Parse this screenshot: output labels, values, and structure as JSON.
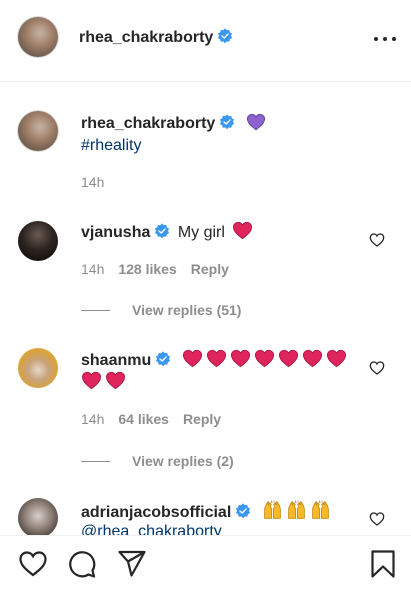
{
  "header": {
    "username": "rhea_chakraborty",
    "more_icon": "more-dots-icon"
  },
  "caption": {
    "username": "rhea_chakraborty",
    "text": "#rheality",
    "time": "14h"
  },
  "comments": [
    {
      "username": "vjanusha",
      "text": "My girl",
      "time": "14h",
      "likes": "128 likes",
      "reply": "Reply",
      "view_replies": "View replies (51)"
    },
    {
      "username": "shaanmu",
      "text": "",
      "time": "14h",
      "likes": "64 likes",
      "reply": "Reply",
      "view_replies": "View replies (2)"
    },
    {
      "username": "adrianjacobsofficial",
      "text": "@rhea_chakraborty"
    }
  ],
  "colors": {
    "verified": "#3897f0",
    "heart_red": "#e0245e",
    "purple_heart": "#8e63ce",
    "muted": "#8e8e8e",
    "hashtag": "#00376b"
  },
  "actions": {
    "like_icon": "heart-outline-icon",
    "comment_icon": "comment-bubble-icon",
    "share_icon": "paper-plane-icon",
    "save_icon": "bookmark-icon"
  }
}
